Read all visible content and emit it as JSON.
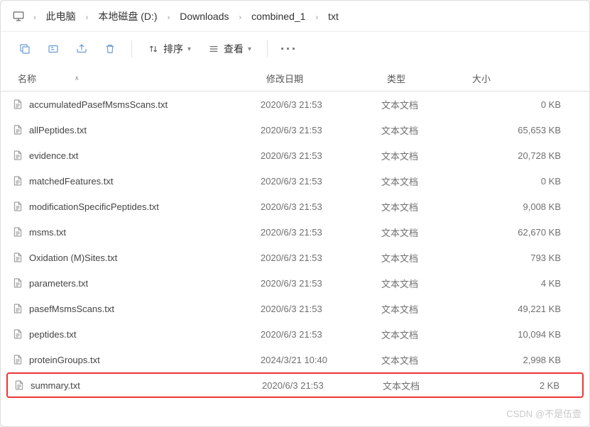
{
  "breadcrumb": {
    "items": [
      "此电脑",
      "本地磁盘 (D:)",
      "Downloads",
      "combined_1",
      "txt"
    ]
  },
  "toolbar": {
    "sort_label": "排序",
    "view_label": "查看"
  },
  "columns": {
    "name": "名称",
    "date": "修改日期",
    "type": "类型",
    "size": "大小"
  },
  "files": [
    {
      "name": "accumulatedPasefMsmsScans.txt",
      "date": "2020/6/3 21:53",
      "type": "文本文档",
      "size": "0 KB"
    },
    {
      "name": "allPeptides.txt",
      "date": "2020/6/3 21:53",
      "type": "文本文档",
      "size": "65,653 KB"
    },
    {
      "name": "evidence.txt",
      "date": "2020/6/3 21:53",
      "type": "文本文档",
      "size": "20,728 KB"
    },
    {
      "name": "matchedFeatures.txt",
      "date": "2020/6/3 21:53",
      "type": "文本文档",
      "size": "0 KB"
    },
    {
      "name": "modificationSpecificPeptides.txt",
      "date": "2020/6/3 21:53",
      "type": "文本文档",
      "size": "9,008 KB"
    },
    {
      "name": "msms.txt",
      "date": "2020/6/3 21:53",
      "type": "文本文档",
      "size": "62,670 KB"
    },
    {
      "name": "Oxidation (M)Sites.txt",
      "date": "2020/6/3 21:53",
      "type": "文本文档",
      "size": "793 KB"
    },
    {
      "name": "parameters.txt",
      "date": "2020/6/3 21:53",
      "type": "文本文档",
      "size": "4 KB"
    },
    {
      "name": "pasefMsmsScans.txt",
      "date": "2020/6/3 21:53",
      "type": "文本文档",
      "size": "49,221 KB"
    },
    {
      "name": "peptides.txt",
      "date": "2020/6/3 21:53",
      "type": "文本文档",
      "size": "10,094 KB"
    },
    {
      "name": "proteinGroups.txt",
      "date": "2024/3/21 10:40",
      "type": "文本文档",
      "size": "2,998 KB"
    },
    {
      "name": "summary.txt",
      "date": "2020/6/3 21:53",
      "type": "文本文档",
      "size": "2 KB",
      "highlighted": true
    }
  ],
  "watermark": "CSDN @不是伍壹"
}
